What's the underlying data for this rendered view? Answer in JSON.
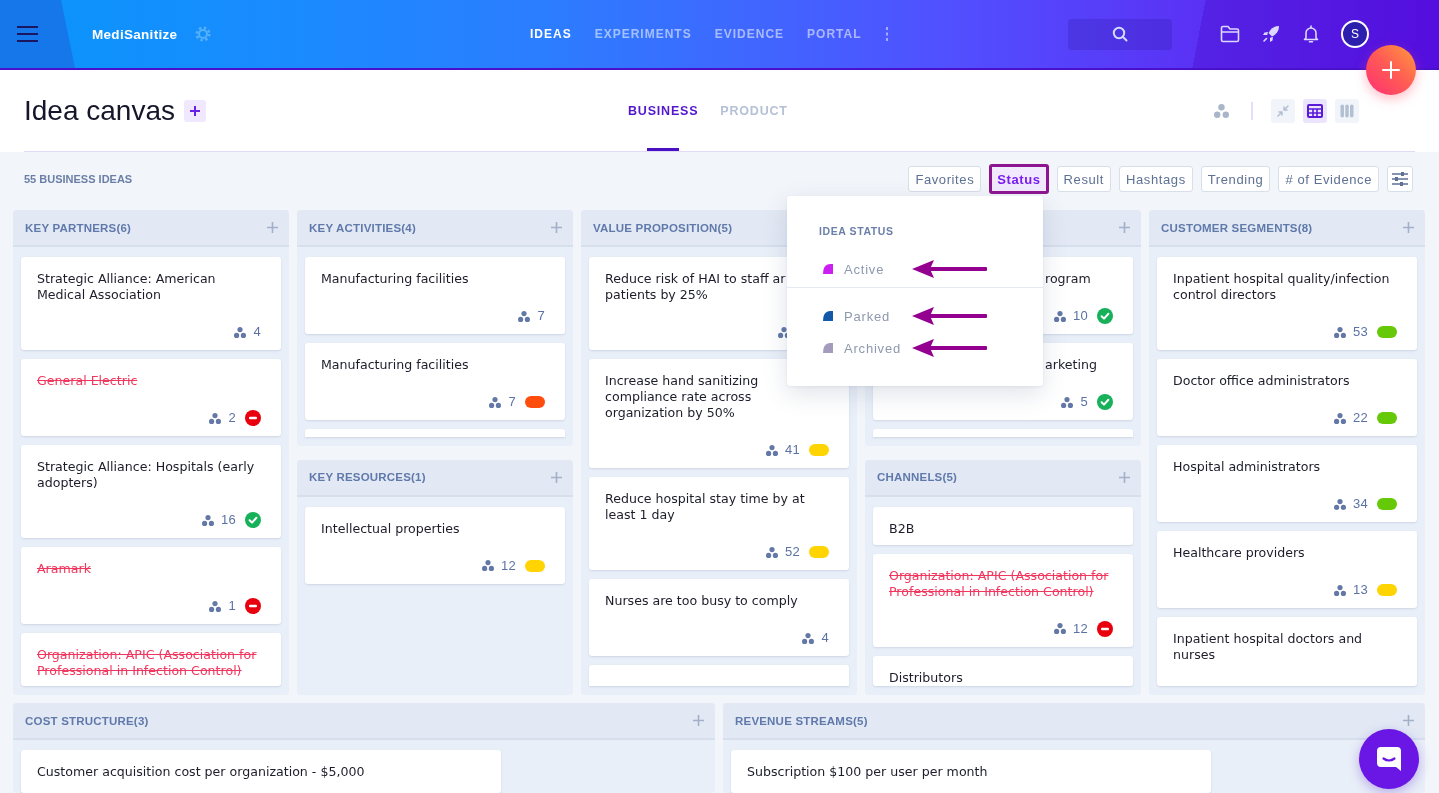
{
  "topbar": {
    "brand": "MediSanitize",
    "nav": [
      {
        "label": "IDEAS",
        "selected": true
      },
      {
        "label": "EXPERIMENTS",
        "selected": false
      },
      {
        "label": "EVIDENCE",
        "selected": false
      },
      {
        "label": "PORTAL",
        "selected": false
      }
    ],
    "avatar": "S"
  },
  "header": {
    "title": "Idea canvas",
    "tabs": [
      {
        "label": "BUSINESS",
        "selected": true
      },
      {
        "label": "PRODUCT",
        "selected": false
      }
    ],
    "view_buttons": [
      {
        "kind": "compress",
        "selected": false
      },
      {
        "kind": "grid",
        "selected": true
      },
      {
        "kind": "columns",
        "selected": false
      }
    ]
  },
  "filters": {
    "count": "55 BUSINESS IDEAS",
    "buttons": [
      {
        "label": "Favorites",
        "selected": false
      },
      {
        "label": "Status",
        "selected": true
      },
      {
        "label": "Result",
        "selected": false
      },
      {
        "label": "Hashtags",
        "selected": false
      },
      {
        "label": "Trending",
        "selected": false
      },
      {
        "label": "# of Evidence",
        "selected": false
      }
    ]
  },
  "status_menu": {
    "heading": "IDEA STATUS",
    "groups": [
      {
        "items": [
          {
            "label": "Active",
            "color": "#cc1ff2",
            "annotated": true
          }
        ]
      },
      {
        "items": [
          {
            "label": "Parked",
            "color": "#1458a8",
            "annotated": true
          },
          {
            "label": "Archived",
            "color": "#a39cbc",
            "annotated": true
          }
        ]
      }
    ]
  },
  "board": {
    "columns": [
      {
        "sections": [
          {
            "title": "KEY PARTNERS(6)",
            "last_card_cut": true,
            "cards": [
              {
                "text": "Strategic Alliance: American Medical Association",
                "archived": false,
                "count": "4"
              },
              {
                "text": "General Electric",
                "archived": true,
                "count": "2",
                "badge": {
                  "kind": "rejected"
                }
              },
              {
                "text": "Strategic Alliance: Hospitals (early adopters)",
                "archived": false,
                "count": "16",
                "badge": {
                  "kind": "validated"
                }
              },
              {
                "text": "Aramark",
                "archived": true,
                "count": "1",
                "badge": {
                  "kind": "rejected"
                }
              },
              {
                "text": "Organization: APIC (Association for Professional in Infection Control)",
                "archived": true
              }
            ]
          }
        ]
      },
      {
        "sections": [
          {
            "title": "KEY ACTIVITIES(4)",
            "card_edge": true,
            "cards": [
              {
                "text": "Manufacturing facilities",
                "archived": false,
                "count": "7"
              },
              {
                "text": "Manufacturing facilities",
                "archived": false,
                "count": "7",
                "badge": {
                  "kind": "pill",
                  "color": "#ff4d0d"
                }
              }
            ]
          },
          {
            "title": "KEY RESOURCES(1)",
            "cards": [
              {
                "text": "Intellectual properties",
                "archived": false,
                "count": "12",
                "badge": {
                  "kind": "pill",
                  "color": "#ffd400"
                }
              }
            ]
          }
        ]
      },
      {
        "sections": [
          {
            "title": "VALUE PROPOSITION(5)",
            "card_edge": true,
            "cards": [
              {
                "text": "Reduce risk of HAI to staff ar\npatients by 25%",
                "archived": false,
                "footer_covered": true
              },
              {
                "text": "Increase hand sanitizing compliance rate across organization by 50%",
                "archived": false,
                "count": "41",
                "badge": {
                  "kind": "pill",
                  "color": "#ffd400"
                }
              },
              {
                "text": "Reduce hospital stay time by at least 1 day",
                "archived": false,
                "count": "52",
                "badge": {
                  "kind": "pill",
                  "color": "#ffd400"
                }
              },
              {
                "text": "Nurses are too busy to comply",
                "archived": false,
                "count": "4"
              }
            ]
          }
        ]
      },
      {
        "sections": [
          {
            "card_edge": true,
            "cards": [
              {
                "text": "rogram",
                "archived": false,
                "count": "10",
                "badge": {
                  "kind": "validated"
                }
              },
              {
                "text": "arketing",
                "archived": false,
                "count": "5",
                "badge": {
                  "kind": "validated"
                }
              }
            ]
          },
          {
            "title": "CHANNELS(5)",
            "last_card_cut": true,
            "cards": [
              {
                "text": "B2B",
                "archived": false
              },
              {
                "text": "Organization: APIC (Association for Professional in Infection Control)",
                "archived": true,
                "count": "12",
                "badge": {
                  "kind": "rejected"
                }
              },
              {
                "text": "Distributors",
                "archived": false
              }
            ]
          }
        ]
      },
      {
        "sections": [
          {
            "title": "CUSTOMER SEGMENTS(8)",
            "last_card_cut": true,
            "cards": [
              {
                "text": "Inpatient hospital quality/infection control directors",
                "archived": false,
                "count": "53",
                "badge": {
                  "kind": "pill",
                  "color": "#66c908"
                }
              },
              {
                "text": "Doctor office administrators",
                "archived": false,
                "count": "22",
                "badge": {
                  "kind": "pill",
                  "color": "#66c908"
                }
              },
              {
                "text": "Hospital administrators",
                "archived": false,
                "count": "34",
                "badge": {
                  "kind": "pill",
                  "color": "#66c908"
                }
              },
              {
                "text": "Healthcare providers",
                "archived": false,
                "count": "13",
                "badge": {
                  "kind": "pill",
                  "color": "#ffd400"
                }
              },
              {
                "text": "Inpatient hospital doctors and nurses",
                "archived": false
              }
            ]
          }
        ]
      }
    ],
    "bottom_row": [
      {
        "title": "COST STRUCTURE(3)",
        "last_card_cut": true,
        "cards": [
          {
            "text": "Customer acquisition cost per organization - $5,000",
            "archived": false
          }
        ]
      },
      {
        "title": "REVENUE STREAMS(5)",
        "last_card_cut": true,
        "cards": [
          {
            "text": "Subscription $100 per user per month",
            "archived": false
          }
        ]
      }
    ]
  }
}
